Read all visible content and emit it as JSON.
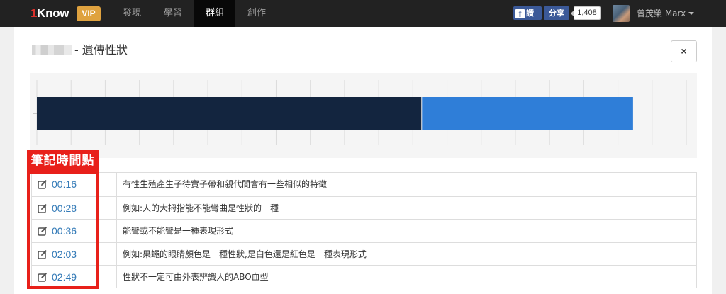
{
  "navbar": {
    "brand_num": "1",
    "brand_text": "Know",
    "vip": "VIP",
    "items": [
      {
        "label": "發現",
        "active": false
      },
      {
        "label": "學習",
        "active": false
      },
      {
        "label": "群組",
        "active": true
      },
      {
        "label": "創作",
        "active": false
      }
    ],
    "fb_like": "讚",
    "fb_share": "分享",
    "fb_count": "1,408",
    "username": "曾茂榮 Marx"
  },
  "header": {
    "title": "- 遺傳性狀",
    "close_label": "×"
  },
  "chart_data": {
    "type": "bar",
    "orientation": "horizontal",
    "x_range": [
      0,
      1
    ],
    "series": [
      {
        "values": [
          0.592
        ],
        "color": "#13253f"
      },
      {
        "values": [
          0.326
        ],
        "color": "#2f7ed8"
      }
    ],
    "grid": true
  },
  "annotation": {
    "label": "筆記時間點"
  },
  "notes": [
    {
      "time": "00:16",
      "text": "有性生殖產生子待實子帶和親代間會有一些相似的特徵"
    },
    {
      "time": "00:28",
      "text": "例如:人的大拇指能不能彎曲是性狀的一種"
    },
    {
      "time": "00:36",
      "text": "能彎或不能彎是一種表現形式"
    },
    {
      "time": "02:03",
      "text": "例如:果蠅的眼睛顏色是一種性狀,是白色還是紅色是一種表現形式"
    },
    {
      "time": "02:49",
      "text": "性狀不一定可由外表辨識人的ABO血型"
    }
  ]
}
